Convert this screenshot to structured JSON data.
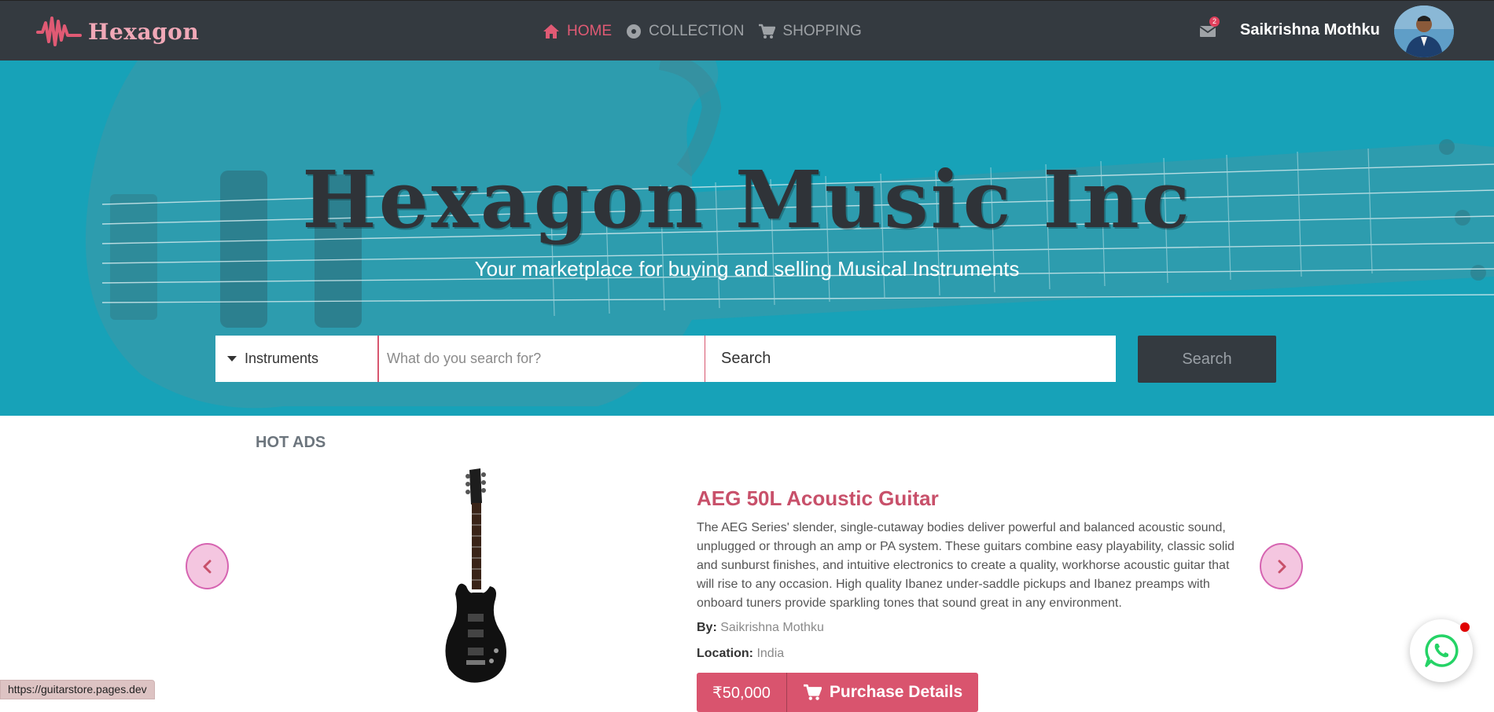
{
  "brand": {
    "name": "Hexagon"
  },
  "nav": {
    "items": [
      {
        "label": "HOME",
        "icon": "home-icon"
      },
      {
        "label": "COLLECTION",
        "icon": "disc-icon"
      },
      {
        "label": "SHOPPING",
        "icon": "cart-icon"
      }
    ]
  },
  "user": {
    "name": "Saikrishna Mothku",
    "notification_count": "2"
  },
  "hero": {
    "title": "Hexagon Music Inc",
    "subtitle": "Your marketplace for buying and selling Musical Instruments"
  },
  "search": {
    "category": "Instruments",
    "placeholder": "What do you search for?",
    "field_text": "Search",
    "button_label": "Search"
  },
  "hot_ads": {
    "title": "HOT ADS",
    "product": {
      "title": "AEG 50L Acoustic Guitar",
      "description": "The AEG Series' slender, single-cutaway bodies deliver powerful and balanced acoustic sound, unplugged or through an amp or PA system. These guitars combine easy playability, classic solid and sunburst finishes, and intuitive electronics to create a quality, workhorse acoustic guitar that will rise to any occasion. High quality Ibanez under-saddle pickups and Ibanez preamps with onboard tuners provide sparkling tones that sound great in any environment.",
      "by_label": "By:",
      "by_value": "Saikrishna Mothku",
      "location_label": "Location:",
      "location_value": "India",
      "price": "₹50,000",
      "purchase_label": "Purchase Details"
    }
  },
  "status_bar": {
    "url": "https://guitarstore.pages.dev"
  },
  "colors": {
    "navbar": "#343a40",
    "hero": "#17a2b8",
    "accent": "#d9546e",
    "brand_pink": "#f0a8b7"
  }
}
